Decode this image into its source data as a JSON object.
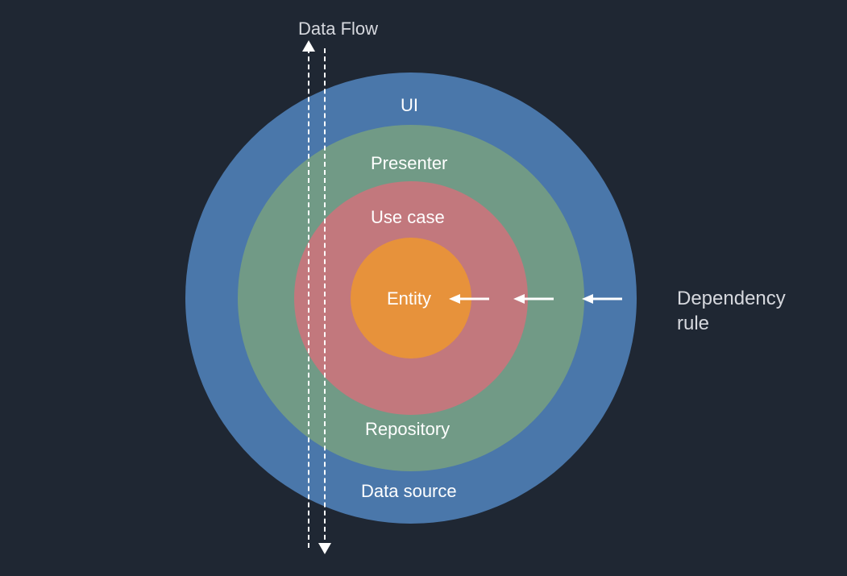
{
  "diagram": {
    "title": "Data Flow",
    "rings": {
      "outer_top": "UI",
      "outer_bottom": "Data source",
      "second_top": "Presenter",
      "second_bottom": "Repository",
      "third_top": "Use case",
      "center": "Entity"
    },
    "dependency_label": "Dependency\nrule",
    "colors": {
      "bg": "#1f2733",
      "ui": "#4a77aa",
      "presenter": "#719a86",
      "usecase": "#c2787d",
      "entity": "#e7923b",
      "text": "#ffffff",
      "side_text": "#d6d8de"
    }
  }
}
